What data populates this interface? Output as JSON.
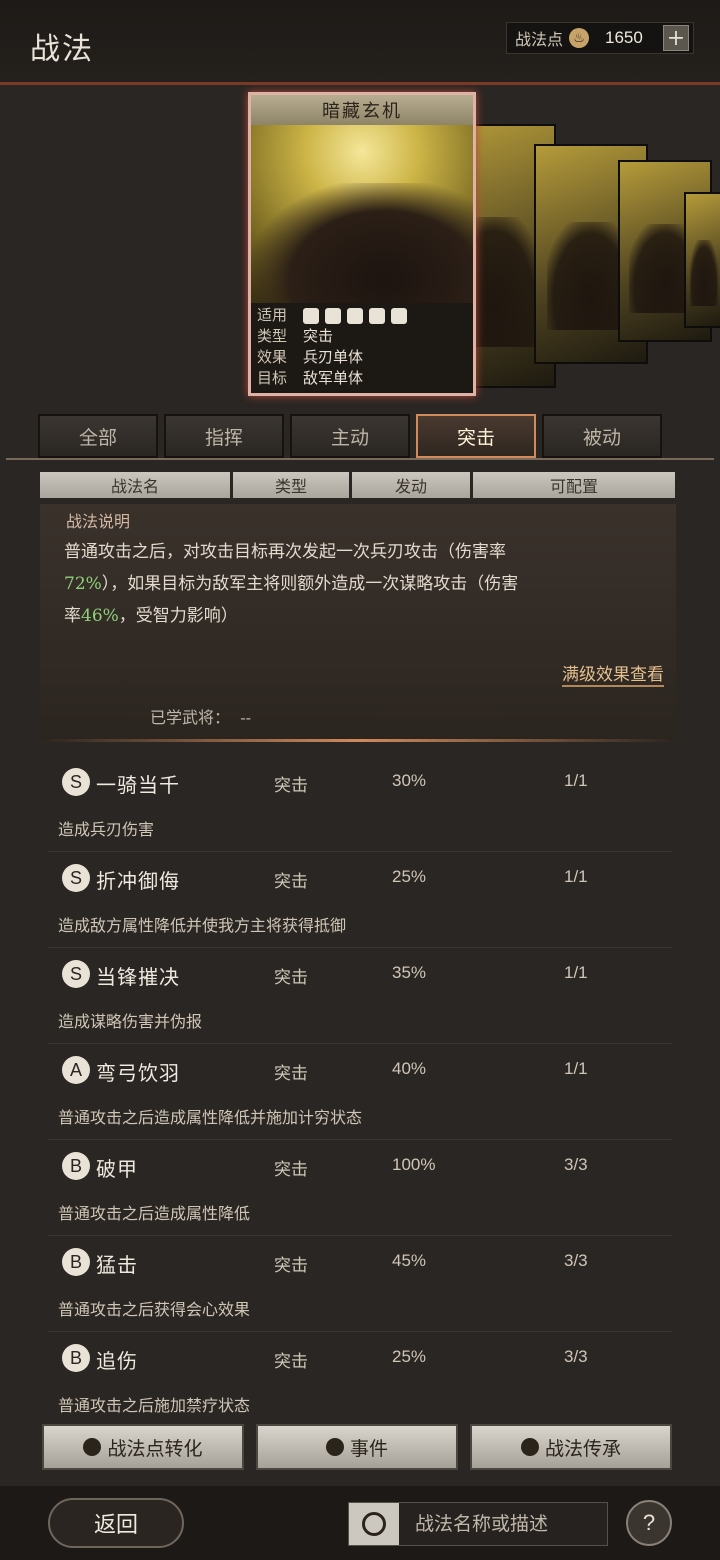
{
  "header": {
    "title": "战法",
    "points_label": "战法点",
    "points_value": "1650",
    "plus_icon": "plus-icon",
    "points_icon": "flame-icon"
  },
  "card": {
    "name": "暗藏玄机",
    "rows": [
      {
        "k": "适用",
        "v": ""
      },
      {
        "k": "类型",
        "v": "突击"
      },
      {
        "k": "效果",
        "v": "兵刃单体"
      },
      {
        "k": "目标",
        "v": "敌军单体"
      }
    ]
  },
  "tabs": [
    "全部",
    "指挥",
    "主动",
    "突击",
    "被动"
  ],
  "active_tab": "突击",
  "columns": [
    "战法名",
    "类型",
    "发动",
    "可配置"
  ],
  "desc": {
    "heading": "战法说明",
    "text_1": "普通攻击之后，对攻击目标再次发起一次兵刃攻击（伤害率",
    "rate_1": "72%",
    "text_2": "），如果目标为敌军主将则额外造成一次谋略攻击（伤害",
    "text_3": "率",
    "rate_2": "46%",
    "text_4": "，受智力影响）",
    "more_label": "满级效果查看",
    "learned_label": "已学武将：",
    "learned_value": "--"
  },
  "items": [
    {
      "grade": "S",
      "name": "一骑当千",
      "type": "突击",
      "rate": "30%",
      "config": "1/1",
      "desc": "造成兵刃伤害"
    },
    {
      "grade": "S",
      "name": "折冲御侮",
      "type": "突击",
      "rate": "25%",
      "config": "1/1",
      "desc": "造成敌方属性降低并使我方主将获得抵御"
    },
    {
      "grade": "S",
      "name": "当锋摧决",
      "type": "突击",
      "rate": "35%",
      "config": "1/1",
      "desc": "造成谋略伤害并伪报"
    },
    {
      "grade": "A",
      "name": "弯弓饮羽",
      "type": "突击",
      "rate": "40%",
      "config": "1/1",
      "desc": "普通攻击之后造成属性降低并施加计穷状态"
    },
    {
      "grade": "B",
      "name": "破甲",
      "type": "突击",
      "rate": "100%",
      "config": "3/3",
      "desc": "普通攻击之后造成属性降低"
    },
    {
      "grade": "B",
      "name": "猛击",
      "type": "突击",
      "rate": "45%",
      "config": "3/3",
      "desc": "普通攻击之后获得会心效果"
    },
    {
      "grade": "B",
      "name": "追伤",
      "type": "突击",
      "rate": "25%",
      "config": "3/3",
      "desc": "普通攻击之后施加禁疗状态"
    }
  ],
  "buttons": {
    "convert": "战法点转化",
    "event": "事件",
    "inherit": "战法传承"
  },
  "bottom": {
    "back": "返回",
    "search_placeholder": "战法名称或描述",
    "help": "?"
  }
}
